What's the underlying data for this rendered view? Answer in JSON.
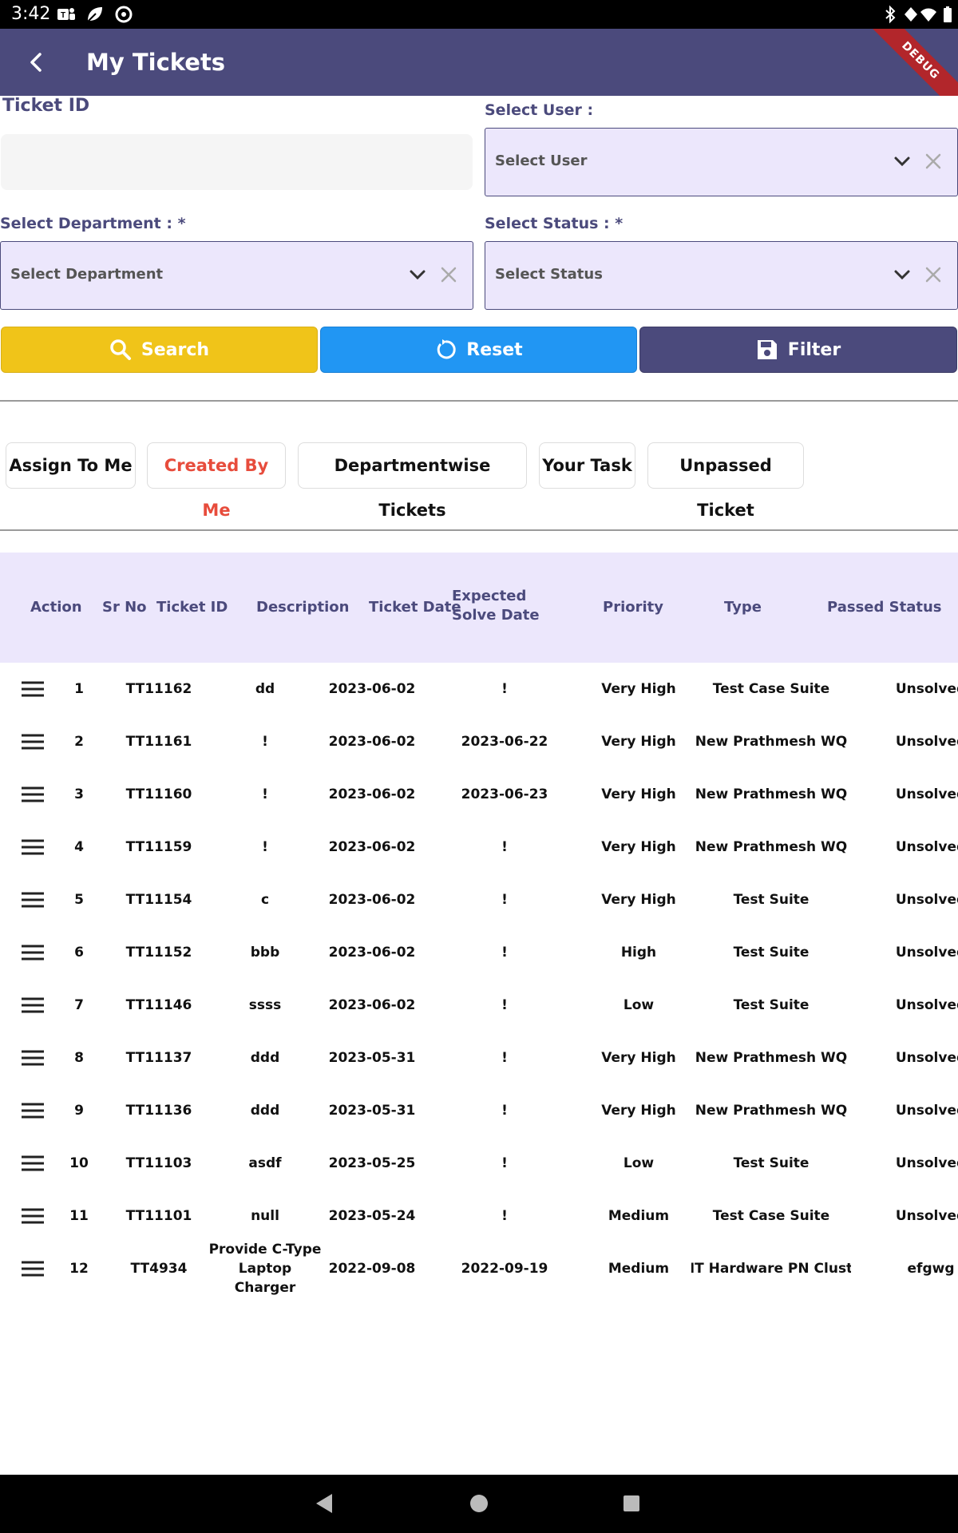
{
  "status_bar": {
    "time": "3:42"
  },
  "app_bar": {
    "title": "My Tickets",
    "debug_label": "DEBUG"
  },
  "form": {
    "ticket_id_label": "Ticket ID",
    "ticket_id_value": "",
    "user_label": "Select User :",
    "user_placeholder": "Select User",
    "department_label": "Select Department : *",
    "department_placeholder": "Select Department",
    "status_label": "Select Status : *",
    "status_placeholder": "Select Status"
  },
  "buttons": {
    "search": "Search",
    "reset": "Reset",
    "filter": "Filter"
  },
  "tabs": [
    {
      "label": "Assign To Me",
      "active": false
    },
    {
      "label": "Created By Me",
      "active": true
    },
    {
      "label": "Departmentwise Tickets",
      "active": false
    },
    {
      "label": "Your Task",
      "active": false
    },
    {
      "label": "Unpassed Ticket",
      "active": false
    }
  ],
  "table": {
    "headers": [
      "Action",
      "Sr No",
      "Ticket ID",
      "Description",
      "Ticket Date",
      "Expected Solve Date",
      "Priority",
      "Type",
      "Passed Status"
    ],
    "rows": [
      [
        "1",
        "TT11162",
        "dd",
        "2023-06-02",
        "!",
        "Very High",
        "Test Case Suite",
        "Unsolved"
      ],
      [
        "2",
        "TT11161",
        "!",
        "2023-06-02",
        "2023-06-22",
        "Very High",
        "New Prathmesh WQ",
        "Unsolved"
      ],
      [
        "3",
        "TT11160",
        "!",
        "2023-06-02",
        "2023-06-23",
        "Very High",
        "New Prathmesh WQ",
        "Unsolved"
      ],
      [
        "4",
        "TT11159",
        "!",
        "2023-06-02",
        "!",
        "Very High",
        "New Prathmesh WQ",
        "Unsolved"
      ],
      [
        "5",
        "TT11154",
        "c",
        "2023-06-02",
        "!",
        "Very High",
        "Test Suite",
        "Unsolved"
      ],
      [
        "6",
        "TT11152",
        "bbb",
        "2023-06-02",
        "!",
        "High",
        "Test Suite",
        "Unsolved"
      ],
      [
        "7",
        "TT11146",
        "ssss",
        "2023-06-02",
        "!",
        "Low",
        "Test Suite",
        "Unsolved"
      ],
      [
        "8",
        "TT11137",
        "ddd",
        "2023-05-31",
        "!",
        "Very High",
        "New Prathmesh WQ",
        "Unsolved"
      ],
      [
        "9",
        "TT11136",
        "ddd",
        "2023-05-31",
        "!",
        "Very High",
        "New Prathmesh WQ",
        "Unsolved"
      ],
      [
        "10",
        "TT11103",
        "asdf",
        "2023-05-25",
        "!",
        "Low",
        "Test Suite",
        "Unsolved"
      ],
      [
        "11",
        "TT11101",
        "null",
        "2023-05-24",
        "!",
        "Medium",
        "Test Case Suite",
        "Unsolved"
      ],
      [
        "12",
        "TT4934",
        "Provide C-Type Laptop Charger",
        "2022-09-08",
        "2022-09-19",
        "Medium",
        "IT Hardware PN Clust",
        "efgwg"
      ]
    ]
  },
  "colors": {
    "primary": "#4b4a7c",
    "lavender": "#ece7fc",
    "search": "#f0c419",
    "reset": "#2196f3",
    "active_tab": "#e74c3c"
  }
}
